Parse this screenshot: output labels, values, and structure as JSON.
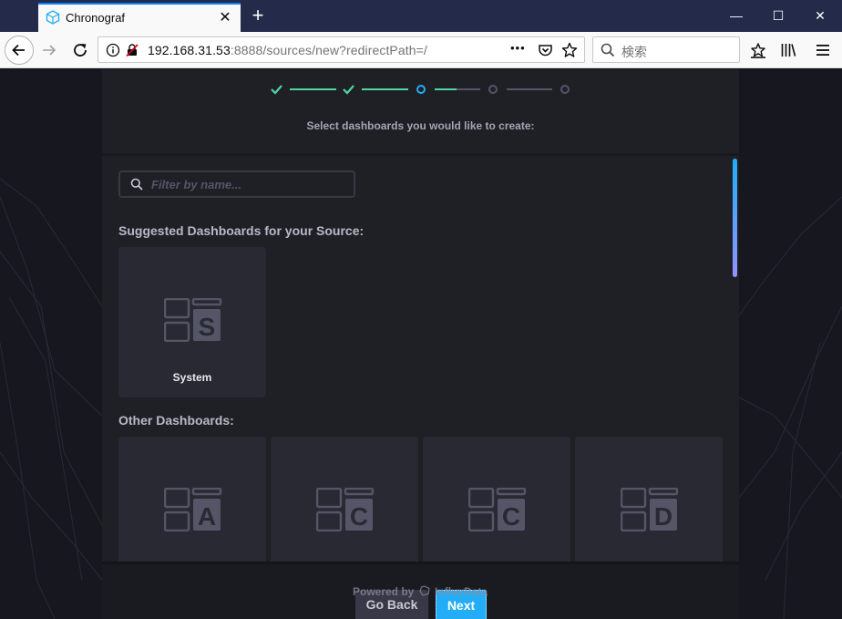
{
  "browser": {
    "tab_title": "Chronograf",
    "tab_close": "✕",
    "new_tab": "+",
    "url_host": "192.168.31.53",
    "url_rest": ":8888/sources/new?redirectPath=/",
    "page_actions": "•••",
    "search_placeholder": "検索",
    "window_controls": {
      "minimize": "—",
      "maximize": "☐",
      "close": "✕"
    }
  },
  "wizard": {
    "steps": [
      {
        "status": "complete"
      },
      {
        "status": "complete"
      },
      {
        "status": "current"
      },
      {
        "status": "pending"
      },
      {
        "status": "pending"
      }
    ],
    "subtitle": "Select dashboards you would like to create:",
    "filter_placeholder": "Filter by name...",
    "suggested_title": "Suggested Dashboards for your Source:",
    "suggested": [
      {
        "letter": "S",
        "label": "System"
      }
    ],
    "other_title": "Other Dashboards:",
    "other": [
      {
        "letter": "A",
        "label": ""
      },
      {
        "letter": "C",
        "label": ""
      },
      {
        "letter": "C",
        "label": ""
      },
      {
        "letter": "D",
        "label": ""
      }
    ],
    "footer": {
      "back_label": "Go Back",
      "next_label": "Next",
      "powered_by": "Powered by",
      "brand": "InfluxData"
    }
  },
  "colors": {
    "complete": "#4ed8a0",
    "current": "#22adf6",
    "pending": "#545667",
    "accent": "#22adf6"
  }
}
